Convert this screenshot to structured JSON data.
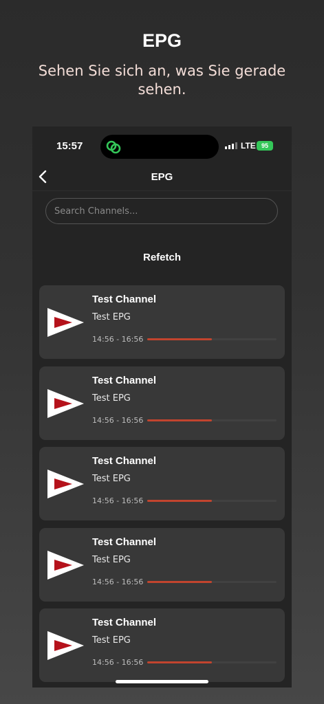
{
  "promo": {
    "title": "EPG",
    "subtitle": "Sehen Sie sich an, was Sie gerade sehen."
  },
  "status_bar": {
    "time": "15:57",
    "network": "LTE",
    "battery": "95"
  },
  "nav": {
    "title": "EPG",
    "back_icon": "chevron-left-icon"
  },
  "search": {
    "placeholder": "Search Channels...",
    "value": ""
  },
  "refetch_label": "Refetch",
  "colors": {
    "accent": "#c2442e",
    "card": "#383838",
    "battery": "#34c759",
    "logo_red": "#b5121b"
  },
  "channels": [
    {
      "name": "Test Channel",
      "program": "Test EPG",
      "time_range": "14:56 - 16:56",
      "progress": 0.5
    },
    {
      "name": "Test Channel",
      "program": "Test EPG",
      "time_range": "14:56 - 16:56",
      "progress": 0.5
    },
    {
      "name": "Test Channel",
      "program": "Test EPG",
      "time_range": "14:56 - 16:56",
      "progress": 0.5
    },
    {
      "name": "Test Channel",
      "program": "Test EPG",
      "time_range": "14:56 - 16:56",
      "progress": 0.5
    },
    {
      "name": "Test Channel",
      "program": "Test EPG",
      "time_range": "14:56 - 16:56",
      "progress": 0.5
    }
  ]
}
